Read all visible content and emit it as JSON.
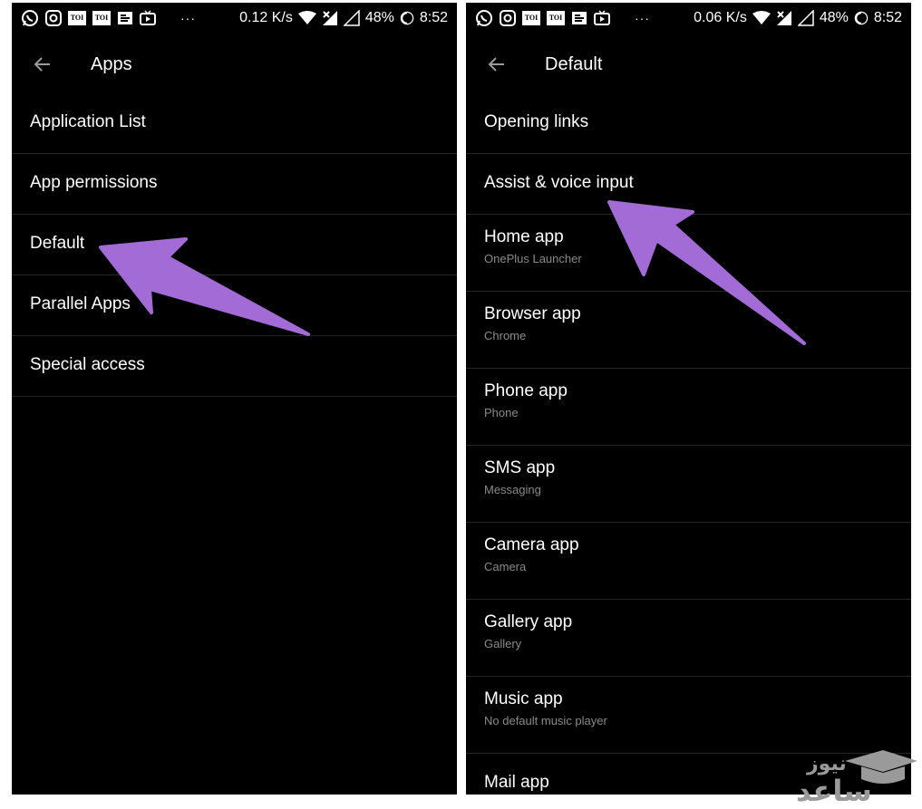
{
  "left_screen": {
    "status": {
      "speed": "0.12 K/s",
      "battery": "48%",
      "time": "8:52",
      "toi_a": "TOI",
      "toi_b": "TOI",
      "dots": "···"
    },
    "title": "Apps",
    "items": [
      {
        "title": "Application List"
      },
      {
        "title": "App permissions"
      },
      {
        "title": "Default"
      },
      {
        "title": "Parallel Apps"
      },
      {
        "title": "Special access"
      }
    ]
  },
  "right_screen": {
    "status": {
      "speed": "0.06 K/s",
      "battery": "48%",
      "time": "8:52",
      "toi_a": "TOI",
      "toi_b": "TOI",
      "dots": "···"
    },
    "title": "Default",
    "items": [
      {
        "title": "Opening links"
      },
      {
        "title": "Assist & voice input"
      },
      {
        "title": "Home app",
        "subtitle": "OnePlus Launcher"
      },
      {
        "title": "Browser app",
        "subtitle": "Chrome"
      },
      {
        "title": "Phone app",
        "subtitle": "Phone"
      },
      {
        "title": "SMS app",
        "subtitle": "Messaging"
      },
      {
        "title": "Camera app",
        "subtitle": "Camera"
      },
      {
        "title": "Gallery app",
        "subtitle": "Gallery"
      },
      {
        "title": "Music app",
        "subtitle": "No default music player"
      },
      {
        "title": "Mail app"
      }
    ]
  },
  "watermark": {
    "line1": "نیوز",
    "line2": "ساعد"
  },
  "colors": {
    "background": "#000000",
    "divider": "#262626",
    "subtitle": "#8a8a8a",
    "annotation_arrow": "#a36bd6"
  }
}
